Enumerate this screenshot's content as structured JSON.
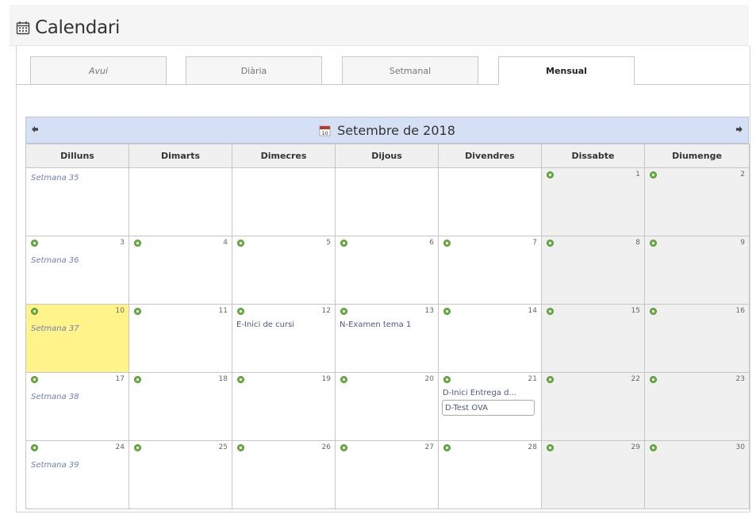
{
  "header": {
    "title": "Calendari",
    "icon": "calendar-icon"
  },
  "tabs": [
    {
      "label": "Avui",
      "active": false
    },
    {
      "label": "Diària",
      "active": false
    },
    {
      "label": "Setmanal",
      "active": false
    },
    {
      "label": "Mensual",
      "active": true
    }
  ],
  "month": {
    "title": "Setembre de 2018",
    "icon_day": "10",
    "prev_icon": "arrow-left-icon",
    "next_icon": "arrow-right-icon"
  },
  "weekdays": [
    "Dilluns",
    "Dimarts",
    "Dimecres",
    "Dijous",
    "Divendres",
    "Dissabte",
    "Diumenge"
  ],
  "weeks": [
    {
      "label": "Setmana 35",
      "days": [
        {
          "num": ""
        },
        {
          "num": ""
        },
        {
          "num": ""
        },
        {
          "num": ""
        },
        {
          "num": ""
        },
        {
          "num": "1",
          "weekend": true
        },
        {
          "num": "2",
          "weekend": true
        }
      ]
    },
    {
      "label": "Setmana 36",
      "days": [
        {
          "num": "3"
        },
        {
          "num": "4"
        },
        {
          "num": "5"
        },
        {
          "num": "6"
        },
        {
          "num": "7"
        },
        {
          "num": "8",
          "weekend": true
        },
        {
          "num": "9",
          "weekend": true
        }
      ]
    },
    {
      "label": "Setmana 37",
      "days": [
        {
          "num": "10",
          "today": true
        },
        {
          "num": "11"
        },
        {
          "num": "12",
          "events": [
            "E-Inici de cursi"
          ]
        },
        {
          "num": "13",
          "events": [
            "N-Examen tema 1"
          ]
        },
        {
          "num": "14"
        },
        {
          "num": "15",
          "weekend": true
        },
        {
          "num": "16",
          "weekend": true
        }
      ]
    },
    {
      "label": "Setmana 38",
      "days": [
        {
          "num": "17"
        },
        {
          "num": "18"
        },
        {
          "num": "19"
        },
        {
          "num": "20"
        },
        {
          "num": "21",
          "events": [
            "D-Inici Entrega d..."
          ],
          "boxed_events": [
            "D-Test OVA"
          ]
        },
        {
          "num": "22",
          "weekend": true
        },
        {
          "num": "23",
          "weekend": true
        }
      ]
    },
    {
      "label": "Setmana 39",
      "days": [
        {
          "num": "24"
        },
        {
          "num": "25"
        },
        {
          "num": "26"
        },
        {
          "num": "27"
        },
        {
          "num": "28"
        },
        {
          "num": "29",
          "weekend": true
        },
        {
          "num": "30",
          "weekend": true
        }
      ]
    }
  ],
  "colors": {
    "month_bar": "#d6e0f5",
    "today": "#fff38a",
    "weekend": "#f0f0f0",
    "add_button": "#6bb043",
    "week_link": "#6f7fb8"
  }
}
